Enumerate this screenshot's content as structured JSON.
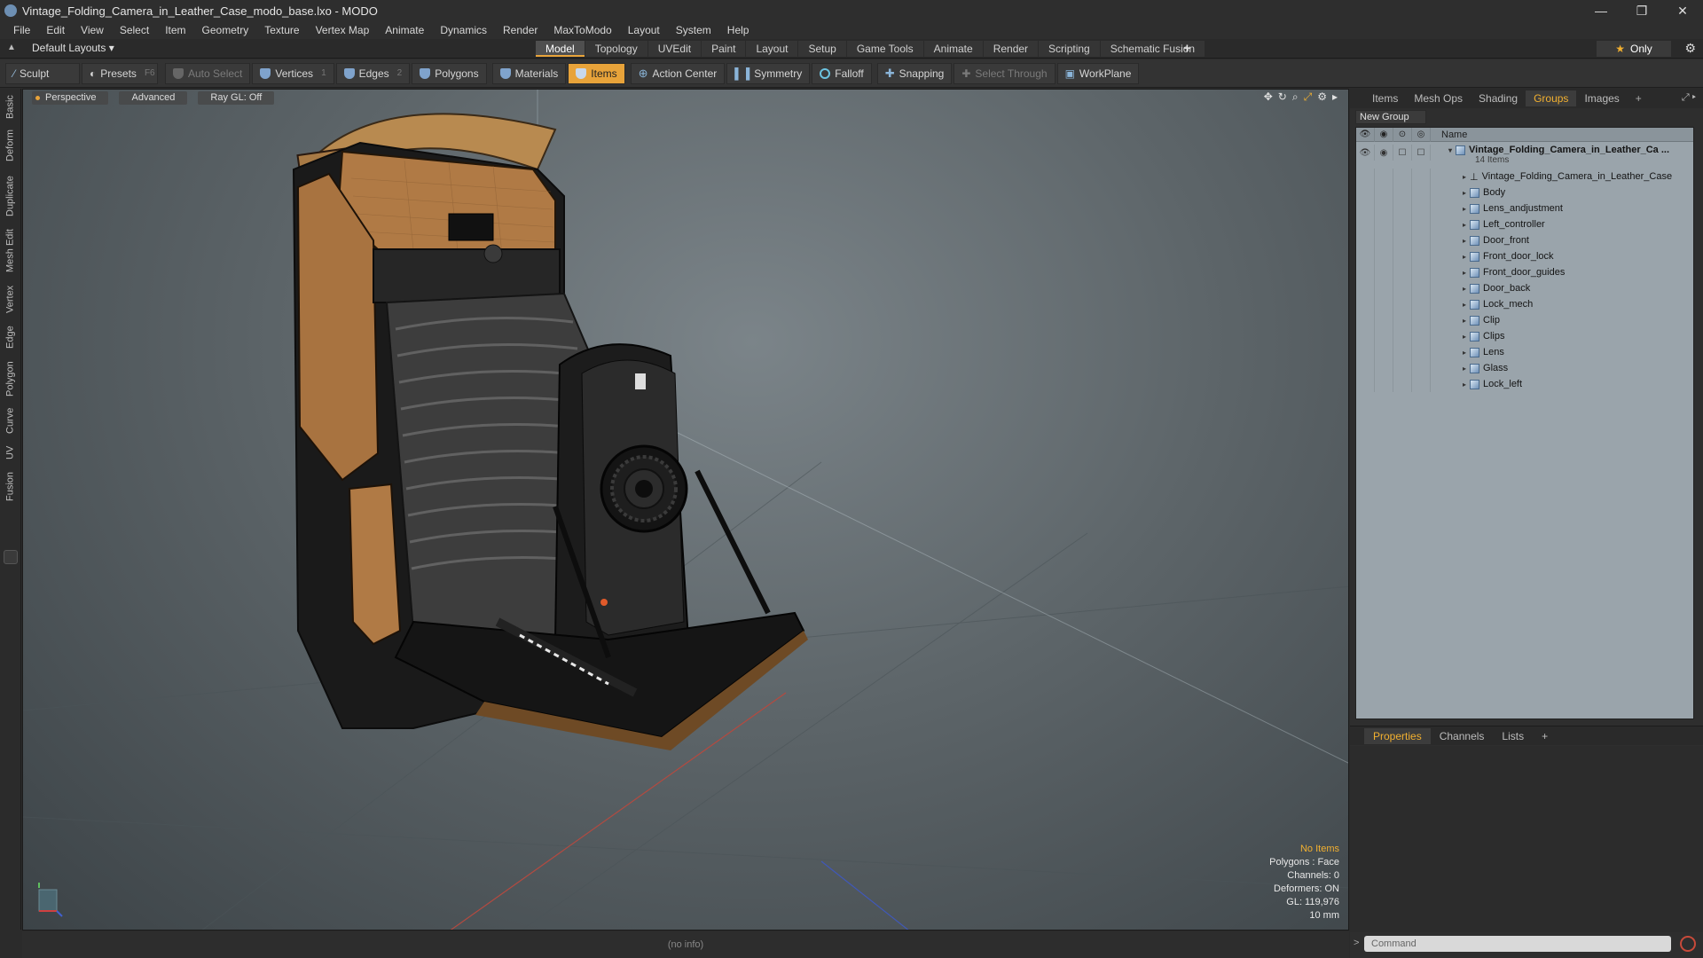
{
  "window": {
    "title": "Vintage_Folding_Camera_in_Leather_Case_modo_base.lxo - MODO",
    "controls": [
      "—",
      "❐",
      "✕"
    ]
  },
  "menu": [
    "File",
    "Edit",
    "View",
    "Select",
    "Item",
    "Geometry",
    "Texture",
    "Vertex Map",
    "Animate",
    "Dynamics",
    "Render",
    "MaxToModo",
    "Layout",
    "System",
    "Help"
  ],
  "layoutbar": {
    "layouts": "Default Layouts ▾",
    "tabs": [
      "Model",
      "Topology",
      "UVEdit",
      "Paint",
      "Layout",
      "Setup",
      "Game Tools",
      "Animate",
      "Render",
      "Scripting",
      "Schematic Fusion"
    ],
    "active_tab": "Model",
    "plus": "+",
    "only": "Only"
  },
  "toolbar": {
    "sculpt": "Sculpt",
    "presets": "Presets",
    "presets_key": "F6",
    "auto_select": "Auto Select",
    "vertices": "Vertices",
    "vertices_num": "1",
    "edges": "Edges",
    "edges_num": "2",
    "polygons": "Polygons",
    "materials": "Materials",
    "items": "Items",
    "action_center": "Action Center",
    "symmetry": "Symmetry",
    "falloff": "Falloff",
    "snapping": "Snapping",
    "select_through": "Select Through",
    "workplane": "WorkPlane"
  },
  "left_tabs": [
    "Basic",
    "Deform",
    "Duplicate",
    "Mesh Edit",
    "Vertex",
    "Edge",
    "Polygon",
    "Curve",
    "UV",
    "Fusion"
  ],
  "viewport": {
    "tabs": [
      "Perspective",
      "Advanced",
      "Ray GL: Off"
    ],
    "info": {
      "no_items": "No Items",
      "polygons": "Polygons : Face",
      "channels": "Channels: 0",
      "deformers": "Deformers: ON",
      "gl": "GL: 119,976",
      "scale": "10 mm"
    }
  },
  "status": "(no info)",
  "right_panel": {
    "tabs": [
      "Items",
      "Mesh Ops",
      "Shading",
      "Groups",
      "Images",
      "+"
    ],
    "active_tab": "Groups",
    "new_group": "New Group",
    "list_header": "Name",
    "group": {
      "name": "Vintage_Folding_Camera_in_Leather_Ca ...",
      "count": "14 Items",
      "items": [
        "Vintage_Folding_Camera_in_Leather_Case",
        "Body",
        "Lens_andjustment",
        "Left_controller",
        "Door_front",
        "Front_door_lock",
        "Front_door_guides",
        "Door_back",
        "Lock_mech",
        "Clip",
        "Clips",
        "Lens",
        "Glass",
        "Lock_left"
      ]
    },
    "props_tabs": [
      "Properties",
      "Channels",
      "Lists",
      "+"
    ],
    "props_active": "Properties",
    "command_placeholder": "Command"
  },
  "colors": {
    "accent": "#e8a33a",
    "viewport_bg": "#5d6569",
    "leather": "#b07a45"
  }
}
